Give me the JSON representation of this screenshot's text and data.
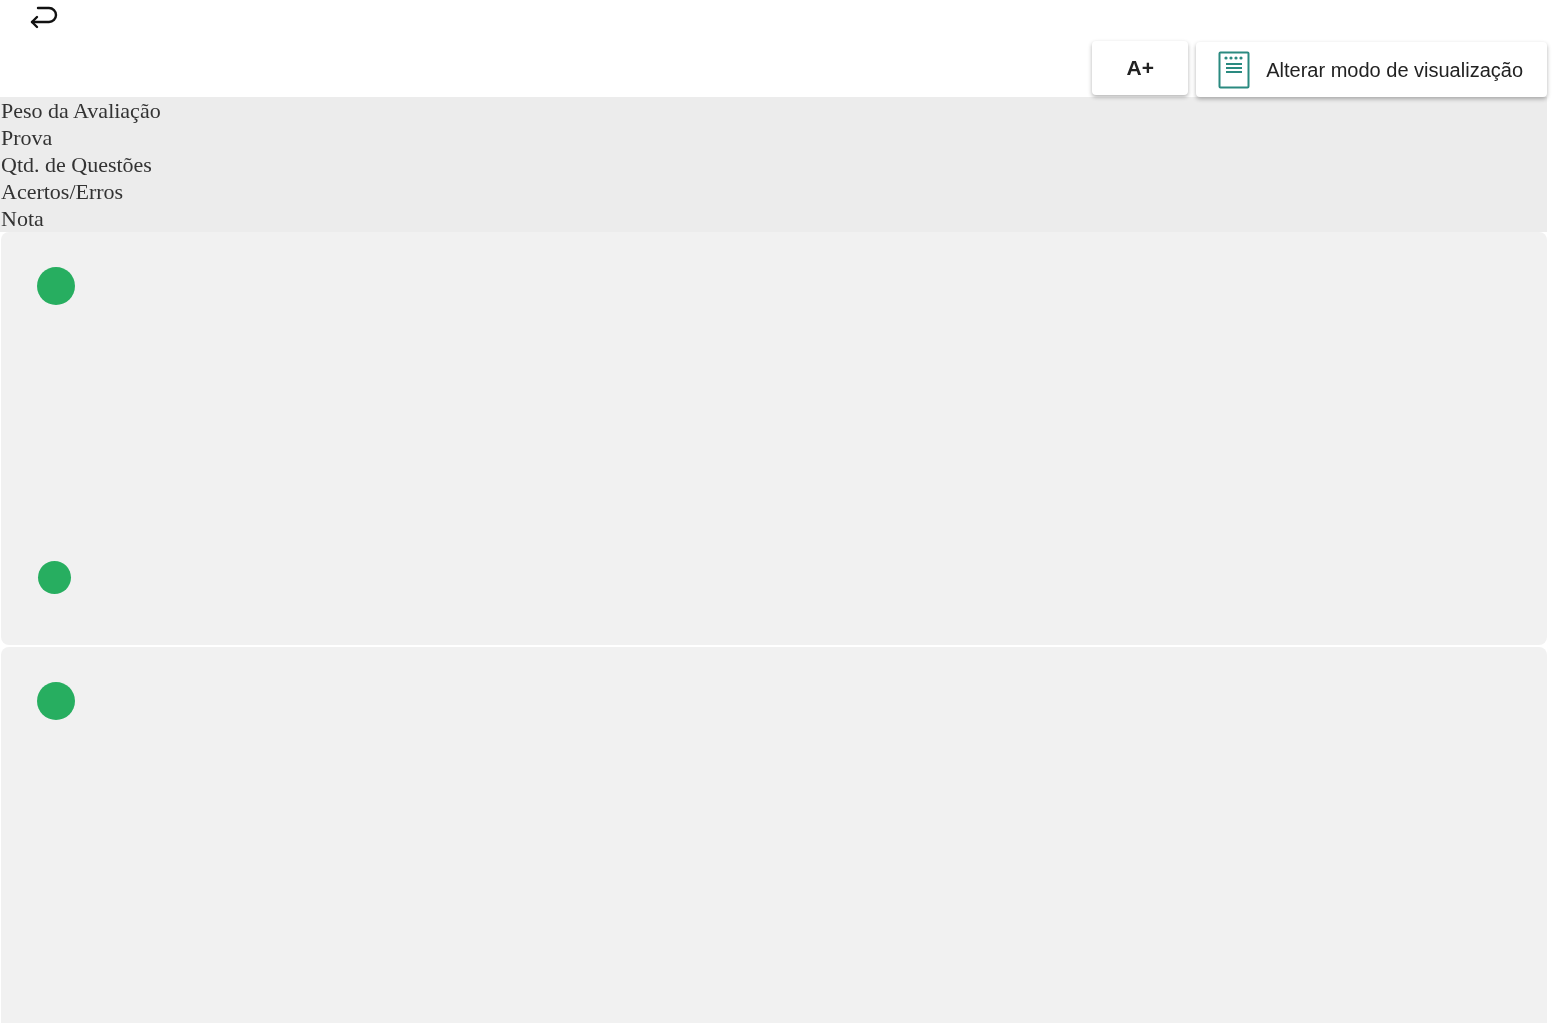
{
  "toolbar": {
    "font_button": "A+",
    "view_button": "Alterar modo de visualização"
  },
  "header_labels": [
    "Peso da Avaliação",
    "Prova",
    "Qtd. de Questões",
    "Acertos/Erros",
    "Nota"
  ],
  "cards": [
    {
      "dots": [
        {
          "kind": "large",
          "color": "#27ae60"
        },
        {
          "kind": "small",
          "color": "#27ae60"
        }
      ]
    },
    {
      "dots": [
        {
          "kind": "large",
          "color": "#27ae60"
        }
      ]
    }
  ]
}
